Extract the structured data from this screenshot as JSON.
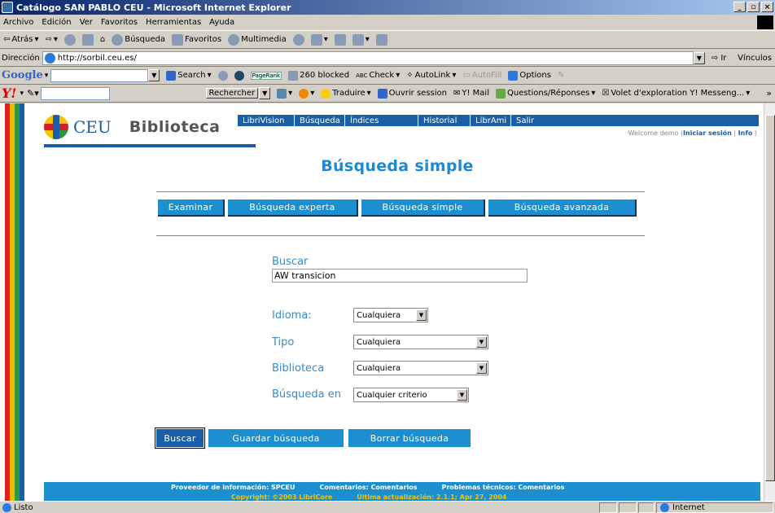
{
  "window": {
    "title": "Catálogo SAN PABLO CEU - Microsoft Internet Explorer",
    "min": "_",
    "max": "▫",
    "close": "×"
  },
  "menu": [
    "Archivo",
    "Edición",
    "Ver",
    "Favoritos",
    "Herramientas",
    "Ayuda"
  ],
  "toolbar": {
    "back": "Atrás",
    "search": "Búsqueda",
    "favorites": "Favoritos",
    "multimedia": "Multimedia"
  },
  "address": {
    "label": "Dirección",
    "url": "http://sorbil.ceu.es/",
    "go": "Ir",
    "links": "Vínculos"
  },
  "google": {
    "logo": "Google",
    "search": "Search",
    "pagerank": "PageRank",
    "blocked": "260 blocked",
    "check": "Check",
    "autolink": "AutoLink",
    "autofill": "AutoFill",
    "options": "Options"
  },
  "yahoo": {
    "logo": "Y!",
    "rechercher": "Rechercher",
    "traduire": "Traduire",
    "ouvrir": "Ouvrir session",
    "mail": "Y! Mail",
    "qr": "Questions/Réponses",
    "volet": "Volet d'exploration Y! Messeng..."
  },
  "page": {
    "logo_text": "CEU",
    "biblioteca": "Biblioteca",
    "topnav": [
      "LibriVision",
      "Búsqueda",
      "Índices",
      "Historial",
      "LibrAmi",
      "Salir"
    ],
    "welcome_prefix": "Welcome demo (",
    "login": "Iniciar sesión",
    "separator": "|",
    "info": "Info",
    "welcome_suffix": ")",
    "title": "Búsqueda simple",
    "tabs": [
      "Examinar",
      "Búsqueda experta",
      "Búsqueda simple",
      "Búsqueda avanzada"
    ],
    "buscar_label": "Buscar",
    "buscar_value": "AW transicion",
    "idioma_label": "Idioma:",
    "idioma_value": "Cualquiera",
    "tipo_label": "Tipo",
    "tipo_value": "Cualquiera",
    "biblioteca_label": "Biblioteca",
    "biblioteca_value": "Cualquiera",
    "busqueda_en_label": "Búsqueda en",
    "busqueda_en_value": "Cualquier criterio",
    "actions": [
      "Buscar",
      "Guardar búsqueda",
      "Borrar búsqueda"
    ],
    "footer": {
      "proveedor": "Proveedor de información: SPCEU",
      "comentarios": "Comentarios: Comentarios",
      "problemas": "Problemas técnicos: Comentarios",
      "copyright": "Copyright: ©2003 LibriCore",
      "actualizacion": "Última actualización: 2.1.1; Apr 27, 2004"
    }
  },
  "status": {
    "text": "Listo",
    "zone": "Internet"
  },
  "colors": {
    "accent": "#1b8fd0",
    "dark_blue": "#1a5ea8",
    "title_blue": "#1a8ad4",
    "label_blue": "#3a8ac8"
  }
}
